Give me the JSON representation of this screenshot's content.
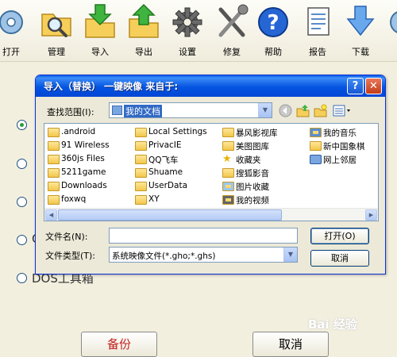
{
  "toolbar": {
    "items": [
      {
        "label": "打开",
        "icon": "open-icon"
      },
      {
        "label": "管理",
        "icon": "manage-icon"
      },
      {
        "label": "导入",
        "icon": "import-icon"
      },
      {
        "label": "导出",
        "icon": "export-icon"
      },
      {
        "label": "设置",
        "icon": "settings-gear-icon"
      },
      {
        "label": "修复",
        "icon": "repair-tools-icon"
      },
      {
        "label": "帮助",
        "icon": "help-icon"
      },
      {
        "label": "报告",
        "icon": "report-icon"
      },
      {
        "label": "下载",
        "icon": "download-icon"
      }
    ]
  },
  "main": {
    "options": [
      {
        "label": "",
        "checked": true
      },
      {
        "label": "",
        "checked": false
      },
      {
        "label": "",
        "checked": false
      },
      {
        "label": "C",
        "checked": false
      },
      {
        "label": "DOS工具箱",
        "checked": false
      }
    ],
    "backup_label": "备份",
    "cancel_label": "取消"
  },
  "watermark": {
    "text": "Bai 经验"
  },
  "dialog": {
    "title": "导入（替换） 一键映像 来自于:",
    "help_label": "?",
    "close_label": "✕",
    "look_in_label": "查找范围(I):",
    "look_in_value": "我的文档",
    "files": [
      {
        "name": ".android",
        "icon": "folder-icon"
      },
      {
        "name": "91 Wireless",
        "icon": "folder-icon"
      },
      {
        "name": "360js Files",
        "icon": "folder-icon"
      },
      {
        "name": "5211game",
        "icon": "folder-icon"
      },
      {
        "name": "Downloads",
        "icon": "folder-icon"
      },
      {
        "name": "foxwq",
        "icon": "folder-icon"
      },
      {
        "name": "Local Settings",
        "icon": "folder-icon"
      },
      {
        "name": "PrivacIE",
        "icon": "folder-icon"
      },
      {
        "name": "QQ飞车",
        "icon": "folder-icon"
      },
      {
        "name": "Shuame",
        "icon": "folder-icon"
      },
      {
        "name": "UserData",
        "icon": "folder-icon"
      },
      {
        "name": "XY",
        "icon": "folder-icon"
      },
      {
        "name": "暴风影视库",
        "icon": "folder-icon"
      },
      {
        "name": "美图图库",
        "icon": "folder-icon"
      },
      {
        "name": "收藏夹",
        "icon": "favorites-star-icon"
      },
      {
        "name": "搜狐影音",
        "icon": "folder-icon"
      },
      {
        "name": "图片收藏",
        "icon": "pictures-folder-icon"
      },
      {
        "name": "我的视频",
        "icon": "videos-folder-icon"
      },
      {
        "name": "我的音乐",
        "icon": "music-folder-icon"
      },
      {
        "name": "新中国象棋",
        "icon": "folder-icon"
      },
      {
        "name": "网上邻居",
        "icon": "network-places-icon"
      }
    ],
    "filename_label": "文件名(N):",
    "filename_value": "",
    "filetype_label": "文件类型(T):",
    "filetype_value": "系统映像文件(*.gho;*.ghs)",
    "open_label": "打开(O)",
    "cancel_label": "取消"
  }
}
